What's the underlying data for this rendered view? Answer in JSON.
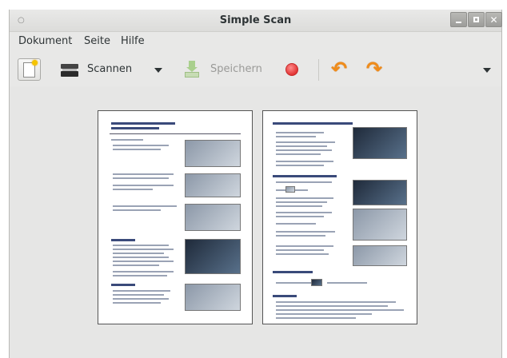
{
  "window": {
    "title": "Simple Scan"
  },
  "menubar": {
    "items": [
      "Dokument",
      "Seite",
      "Hilfe"
    ]
  },
  "toolbar": {
    "new_icon": "new-document-icon",
    "scan_icon": "scanner-icon",
    "scan_label": "Scannen",
    "save_icon": "save-icon",
    "save_label": "Speichern",
    "save_enabled": false,
    "stop_icon": "stop-icon",
    "rotate_left_icon": "rotate-left-icon",
    "rotate_right_icon": "rotate-right-icon"
  },
  "colors": {
    "accent_orange": "#f08c1a",
    "stop_red": "#e23434",
    "save_green": "#a9cf8d"
  },
  "pages": [
    {
      "name": "scanned-page-1"
    },
    {
      "name": "scanned-page-2"
    }
  ]
}
